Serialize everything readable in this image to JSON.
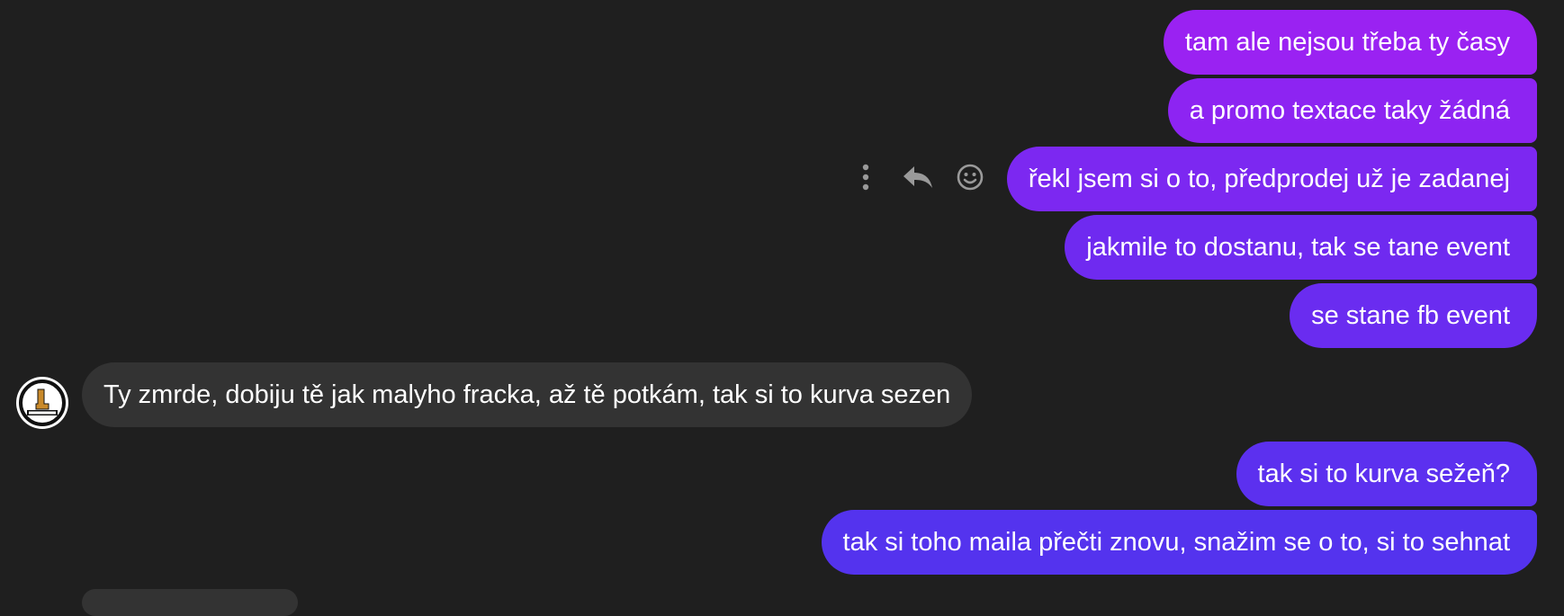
{
  "messages": [
    {
      "text": "tam ale nejsou třeba ty časy"
    },
    {
      "text": "a promo textace taky žádná"
    },
    {
      "text": "řekl jsem si o to, předprodej už je zadanej"
    },
    {
      "text": "jakmile to dostanu, tak se tane event"
    },
    {
      "text": "se stane fb event"
    },
    {
      "text": "Ty zmrde, dobiju tě jak malyho fracka, až tě potkám, tak si to kurva sezen"
    },
    {
      "text": "tak si to kurva sežeň?"
    },
    {
      "text": "tak si toho maila přečti znovu, snažim se o to, si to sehnat"
    }
  ],
  "message_actions": {
    "icons": [
      "more-options-icon",
      "reply-icon",
      "emoji-reaction-icon"
    ]
  },
  "colors": {
    "background": "#1f1f1f",
    "incoming_bubble": "#333333",
    "outgoing_gradient_top": "#9a22f2",
    "outgoing_gradient_bottom": "#5433ee",
    "action_icon": "#9a9a9a"
  }
}
